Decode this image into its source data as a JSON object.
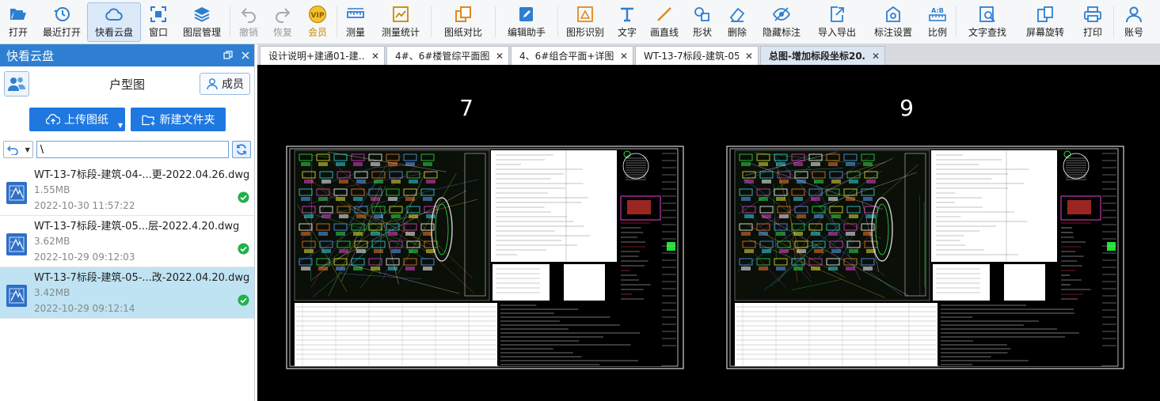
{
  "toolbar": [
    {
      "id": "open",
      "label": "打开",
      "icon": "folder-open-icon",
      "state": "normal"
    },
    {
      "id": "recent",
      "label": "最近打开",
      "icon": "history-icon",
      "state": "normal"
    },
    {
      "id": "cloud",
      "label": "快看云盘",
      "icon": "cloud-icon",
      "state": "active"
    },
    {
      "id": "window",
      "label": "窗口",
      "icon": "window-icon",
      "state": "normal"
    },
    {
      "id": "layers",
      "label": "图层管理",
      "icon": "layers-icon",
      "state": "normal"
    },
    {
      "id": "undo",
      "label": "撤销",
      "icon": "undo-icon",
      "state": "disabled"
    },
    {
      "id": "redo",
      "label": "恢复",
      "icon": "redo-icon",
      "state": "disabled"
    },
    {
      "id": "vip",
      "label": "会员",
      "icon": "vip-icon",
      "state": "vip"
    },
    {
      "id": "measure",
      "label": "测量",
      "icon": "measure-icon",
      "state": "normal"
    },
    {
      "id": "measure-stats",
      "label": "测量统计",
      "icon": "measure-stats-icon",
      "state": "normal"
    },
    {
      "id": "compare",
      "label": "图纸对比",
      "icon": "compare-icon",
      "state": "normal"
    },
    {
      "id": "edit-assist",
      "label": "编辑助手",
      "icon": "edit-assist-icon",
      "state": "normal"
    },
    {
      "id": "shape-recog",
      "label": "图形识别",
      "icon": "shape-recognition-icon",
      "state": "normal"
    },
    {
      "id": "text",
      "label": "文字",
      "icon": "text-icon",
      "state": "normal"
    },
    {
      "id": "line",
      "label": "画直线",
      "icon": "line-icon",
      "state": "normal"
    },
    {
      "id": "shape",
      "label": "形状",
      "icon": "shape-icon",
      "state": "normal"
    },
    {
      "id": "delete",
      "label": "删除",
      "icon": "eraser-icon",
      "state": "normal"
    },
    {
      "id": "hide-annot",
      "label": "隐藏标注",
      "icon": "eye-hidden-icon",
      "state": "normal"
    },
    {
      "id": "import-export",
      "label": "导入导出",
      "icon": "import-export-icon",
      "state": "normal"
    },
    {
      "id": "annot-settings",
      "label": "标注设置",
      "icon": "annotation-settings-icon",
      "state": "normal"
    },
    {
      "id": "scale",
      "label": "比例",
      "icon": "scale-icon",
      "state": "normal"
    },
    {
      "id": "text-search",
      "label": "文字查找",
      "icon": "text-search-icon",
      "state": "normal"
    },
    {
      "id": "rotate",
      "label": "屏幕旋转",
      "icon": "rotate-screen-icon",
      "state": "normal"
    },
    {
      "id": "print",
      "label": "打印",
      "icon": "print-icon",
      "state": "normal"
    },
    {
      "id": "account",
      "label": "账号",
      "icon": "user-icon",
      "state": "normal"
    }
  ],
  "sidebar": {
    "title": "快看云盘",
    "folder": "户型图",
    "members_label": "成员",
    "upload_label": "上传图纸",
    "new_folder_label": "新建文件夹",
    "path": "\\",
    "files": [
      {
        "name": "WT-13-7标段-建筑-04-...更-2022.04.26.dwg",
        "size": "1.55MB",
        "date": "2022-10-30 11:57:22",
        "synced": true,
        "selected": false
      },
      {
        "name": "WT-13-7标段-建筑-05...层-2022.4.20.dwg",
        "size": "3.62MB",
        "date": "2022-10-29 09:12:03",
        "synced": true,
        "selected": false
      },
      {
        "name": "WT-13-7标段-建筑-05-...改-2022.04.20.dwg",
        "size": "3.42MB",
        "date": "2022-10-29 09:12:14",
        "synced": true,
        "selected": true
      }
    ]
  },
  "tabs": [
    {
      "label": "设计说明+建通01-建…",
      "active": false
    },
    {
      "label": "4#、6#楼管综平面图",
      "active": false
    },
    {
      "label": "4、6#组合平面+详图",
      "active": false
    },
    {
      "label": "WT-13-7标段-建筑-05…",
      "active": false
    },
    {
      "label": "总图-增加标段坐标20…",
      "active": true
    }
  ],
  "drawing": {
    "sheets": [
      {
        "number": "7"
      },
      {
        "number": "9"
      }
    ]
  },
  "colors": {
    "accent": "#2e7fd1",
    "button_blue": "#1f78e0",
    "selected_row": "#bfe3f3",
    "canvas": "#000000"
  }
}
